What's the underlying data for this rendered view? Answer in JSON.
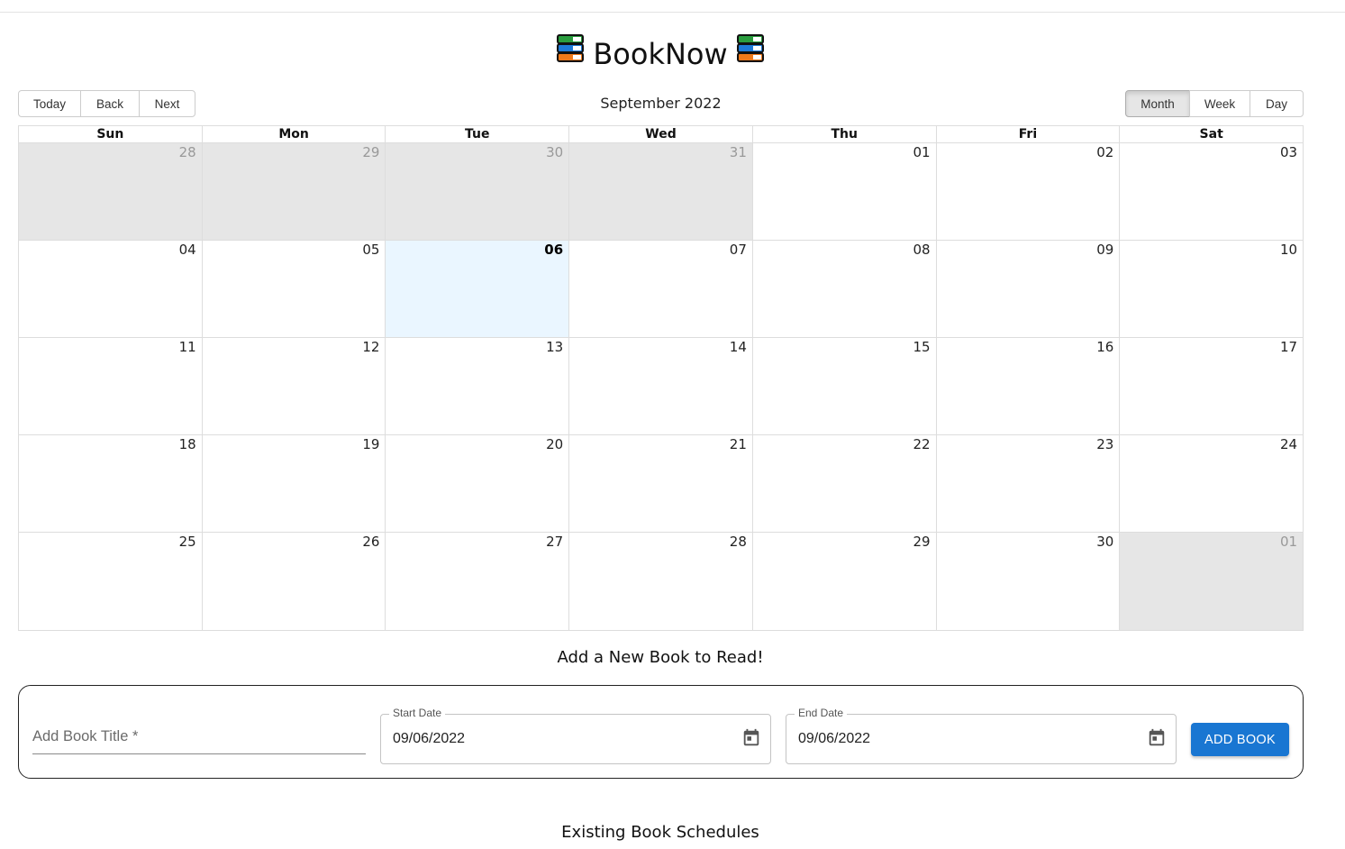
{
  "app": {
    "title": "BookNow"
  },
  "toolbar": {
    "today_label": "Today",
    "back_label": "Back",
    "next_label": "Next",
    "month_label": "September 2022",
    "view_month_label": "Month",
    "view_week_label": "Week",
    "view_day_label": "Day",
    "active_view": "Month"
  },
  "calendar": {
    "weekdays": [
      "Sun",
      "Mon",
      "Tue",
      "Wed",
      "Thu",
      "Fri",
      "Sat"
    ],
    "weeks": [
      [
        "28",
        "29",
        "30",
        "31",
        "01",
        "02",
        "03"
      ],
      [
        "04",
        "05",
        "06",
        "07",
        "08",
        "09",
        "10"
      ],
      [
        "11",
        "12",
        "13",
        "14",
        "15",
        "16",
        "17"
      ],
      [
        "18",
        "19",
        "20",
        "21",
        "22",
        "23",
        "24"
      ],
      [
        "25",
        "26",
        "27",
        "28",
        "29",
        "30",
        "01"
      ]
    ],
    "today": "06",
    "colors": {
      "off_range": "#e6e6e6",
      "today": "#eaf6ff",
      "border": "#dddddd"
    }
  },
  "add_section": {
    "heading": "Add a New Book to Read!",
    "title_placeholder": "Add Book Title *",
    "start_label": "Start Date",
    "start_value": "09/06/2022",
    "end_label": "End Date",
    "end_value": "09/06/2022",
    "add_button_label": "ADD BOOK",
    "accent_color": "#1976d2"
  },
  "existing_section": {
    "heading": "Existing Book Schedules"
  }
}
